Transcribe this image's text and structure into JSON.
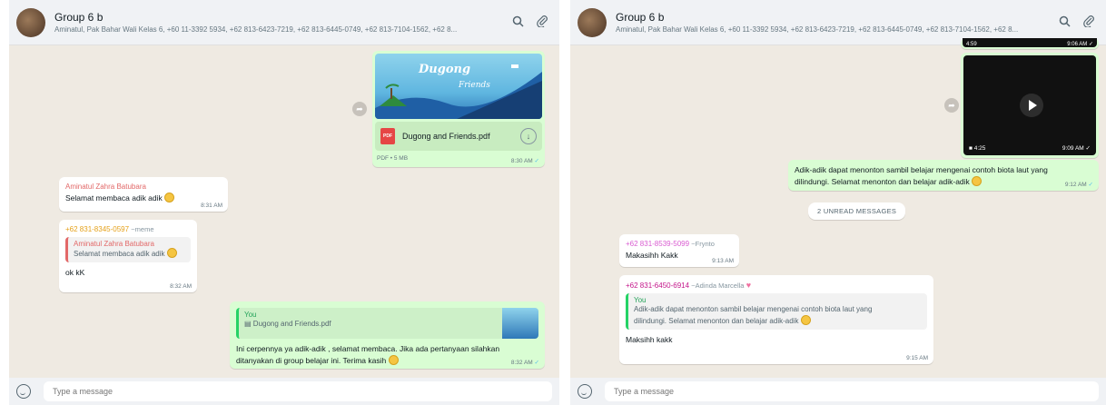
{
  "chat": {
    "name": "Group 6 b",
    "members": "Aminatul, Pak Bahar Wali Kelas 6, +60 11-3392 5934, +62 813-6423-7219, +62 813-6445-0749, +62 813-7104-1562, +62 8..."
  },
  "composer": {
    "placeholder": "Type a message"
  },
  "left": {
    "pdf_message": {
      "thumb_title": "Dugong",
      "thumb_subtitle": "Friends",
      "filename": "Dugong and Friends.pdf",
      "file_badge": "PDF",
      "meta": "PDF • 5 MB",
      "time": "8:30 AM"
    },
    "msg_aminatul": {
      "sender": "Aminatul Zahra Batubara",
      "text": "Selamat membaca adik adik",
      "time": "8:31 AM"
    },
    "msg_meme": {
      "sender": "+62 831-8345-0597",
      "alias": "~meme",
      "quote_sender": "Aminatul Zahra Batubara",
      "quote_text": "Selamat membaca adik adik",
      "text": "ok kK",
      "time": "8:32 AM"
    },
    "msg_you": {
      "quote_sender": "You",
      "quote_text": "Dugong and Friends.pdf",
      "text": "Ini cerpennya ya adik-adik , selamat membaca. Jika ada pertanyaan silahkan ditanyakan di group belajar ini. Terima kasih",
      "time": "8:32 AM"
    }
  },
  "right": {
    "video1": {
      "duration": "4:59",
      "time": "9:06 AM"
    },
    "video2": {
      "duration": "4:25",
      "time": "9:09 AM"
    },
    "msg_you": {
      "text": "Adik-adik dapat menonton sambil belajar mengenai contoh biota laut yang dilindungi. Selamat menonton dan belajar adik-adik",
      "time": "9:12 AM"
    },
    "unread": "2 UNREAD MESSAGES",
    "msg_frynto": {
      "sender": "+62 831-8539-5099",
      "alias": "~Frynto",
      "text": "Makasihh Kakk",
      "time": "9:13 AM"
    },
    "msg_adinda": {
      "sender": "+62 831-6450-6914",
      "alias": "~Adinda Marcella",
      "quote_sender": "You",
      "quote_text": "Adik-adik dapat menonton sambil belajar mengenai contoh biota laut yang dilindungi. Selamat menonton dan belajar adik-adik",
      "text": "Maksihh kakk",
      "time": "9:15 AM"
    }
  },
  "colors": {
    "outgoing": "#d9fdd3",
    "incoming": "#ffffff",
    "chat_bg": "#efeae2",
    "tick": "#53bdeb"
  }
}
